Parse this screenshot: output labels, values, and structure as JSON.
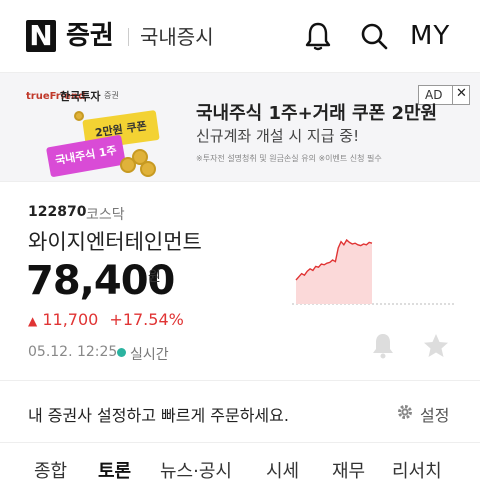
{
  "header": {
    "logo_letter": "N",
    "logo_text": "증권",
    "section": "국내증시",
    "my_label": "MY",
    "icons": [
      "bell-icon",
      "search-icon"
    ]
  },
  "ad": {
    "brand_en": "trueFriend",
    "brand_ko": "한국투자",
    "brand_sub": "증권",
    "ticket_top": "2만원 쿠폰",
    "ticket_bottom": "국내주식 1주",
    "badge": "AD",
    "close": "✕",
    "headline": "국내주식 1주+거래 쿠폰 2만원",
    "subline": "신규계좌 개설 시 지급 중!",
    "note": "※투자전 설명청취 및 원금손실 유의 ※이벤트 신청 필수"
  },
  "stock": {
    "code": "122870",
    "market": "코스닥",
    "name": "와이지엔터테인먼트",
    "price": "78,400",
    "currency": "원",
    "change_arrow": "▲",
    "change_abs": "11,700",
    "change_pct": "+17.54%",
    "timestamp": "05.12. 12:25",
    "live_label": "실시간",
    "colors": {
      "up": "#e03434",
      "live": "#2bb3a0"
    }
  },
  "chart_data": {
    "type": "area",
    "trend": "intraday price, sharp rise",
    "values": [
      0.3,
      0.34,
      0.38,
      0.36,
      0.41,
      0.44,
      0.42,
      0.47,
      0.46,
      0.5,
      0.49,
      0.51,
      0.52,
      0.55,
      0.53,
      0.7,
      0.78,
      0.74,
      0.8,
      0.77,
      0.75,
      0.76,
      0.74,
      0.73,
      0.75,
      0.74,
      0.77,
      0.76
    ]
  },
  "broker": {
    "message": "내 증권사 설정하고 빠르게 주문하세요.",
    "settings_label": "설정"
  },
  "tabs": [
    {
      "label": "종합",
      "active": false
    },
    {
      "label": "토론",
      "active": true
    },
    {
      "label": "뉴스·공시",
      "active": false
    },
    {
      "label": "시세",
      "active": false
    },
    {
      "label": "재무",
      "active": false
    },
    {
      "label": "리서치",
      "active": false
    }
  ]
}
